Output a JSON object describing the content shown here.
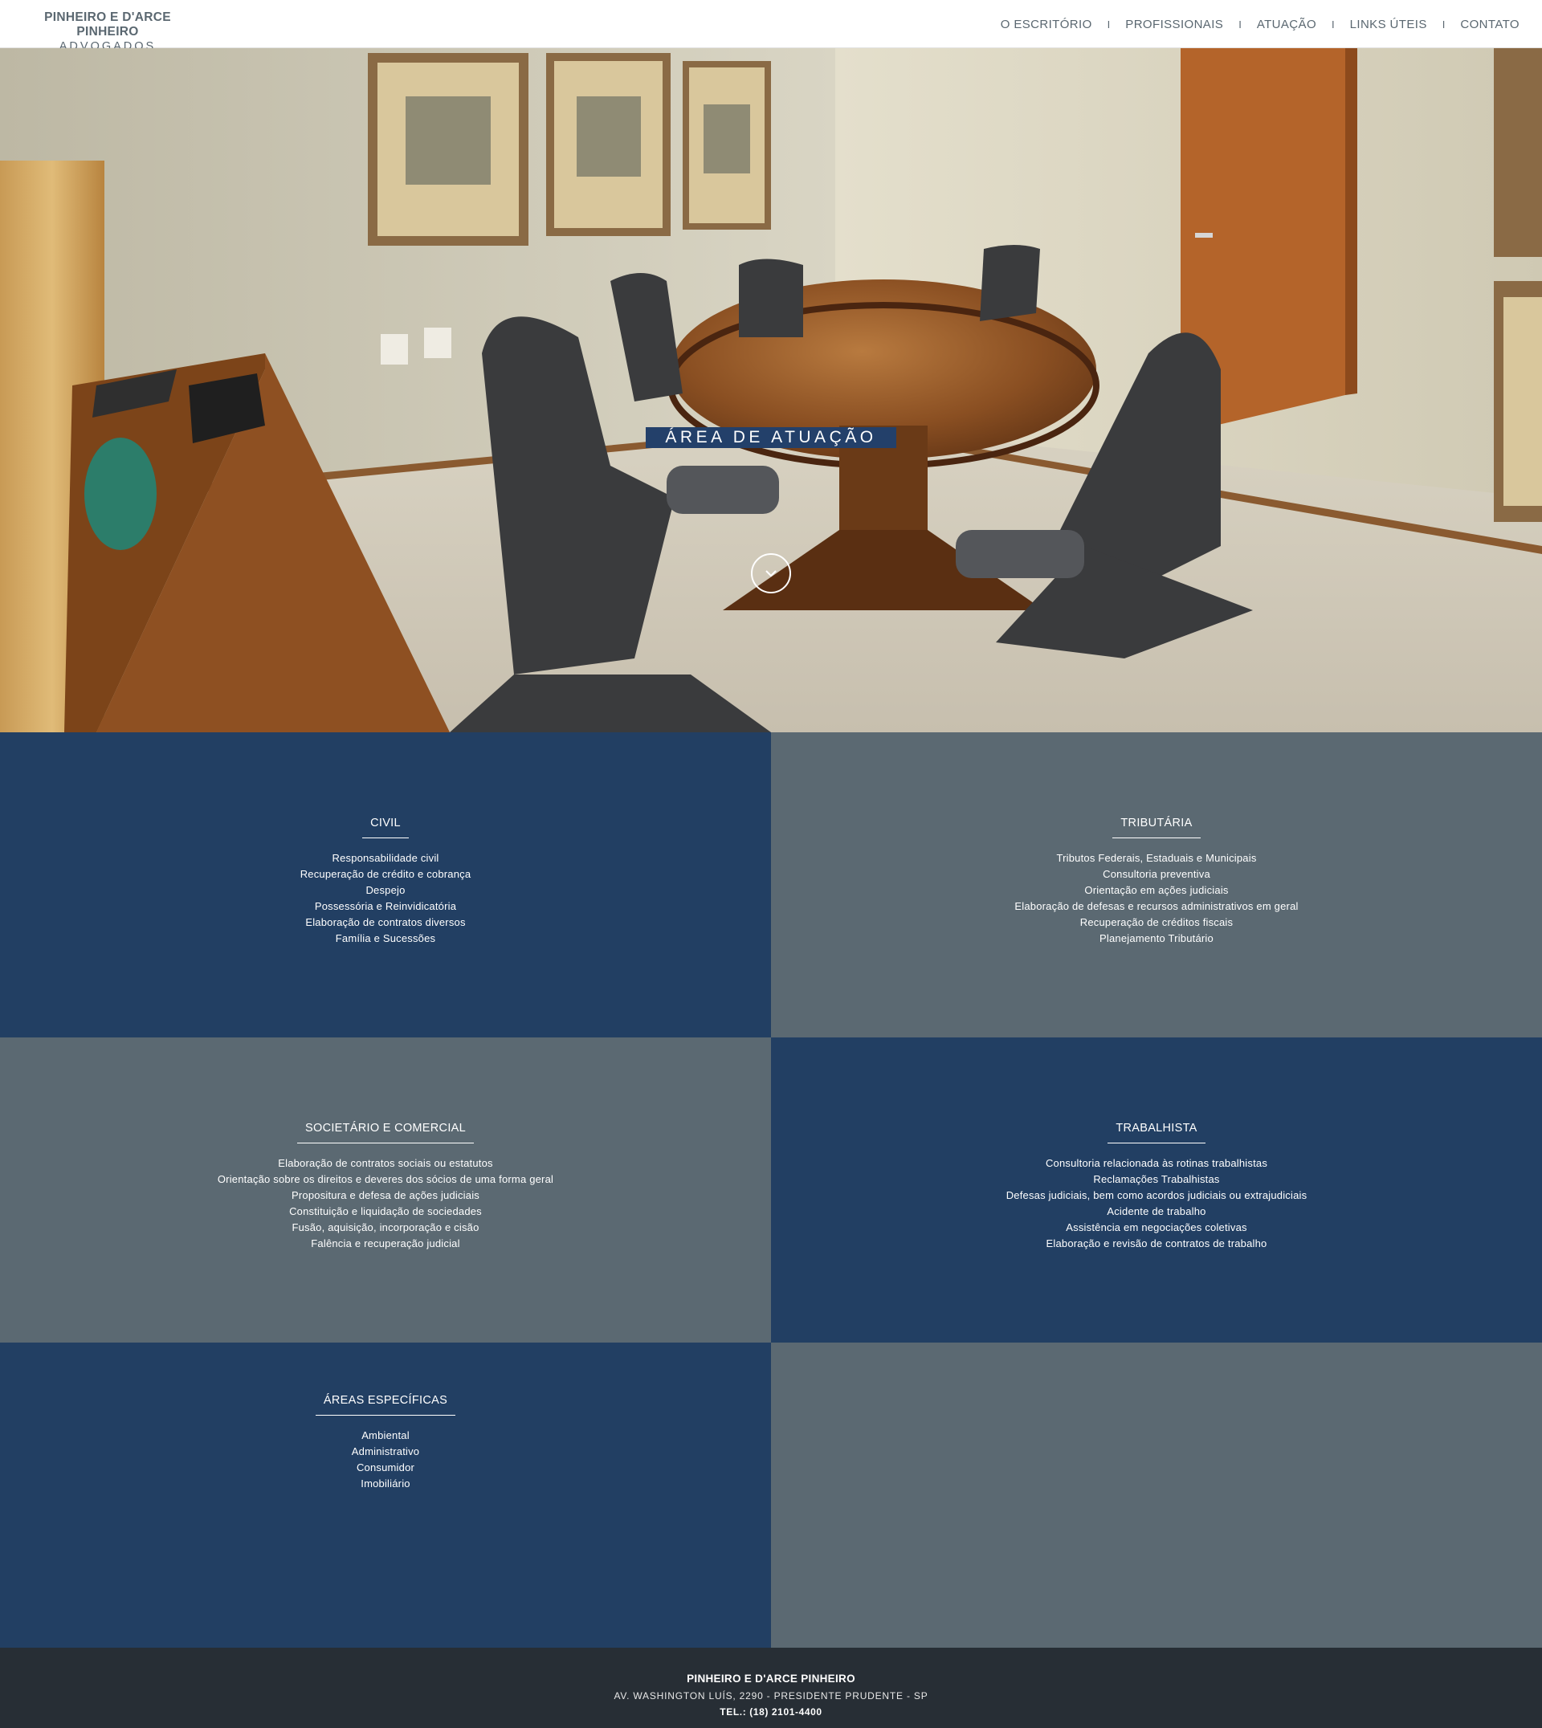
{
  "header": {
    "logo_line1": "PINHEIRO E D'ARCE PINHEIRO",
    "logo_line2": "ADVOGADOS",
    "nav": [
      {
        "label": "O ESCRITÓRIO"
      },
      {
        "label": "PROFISSIONAIS"
      },
      {
        "label": "ATUAÇÃO"
      },
      {
        "label": "LINKS ÚTEIS"
      },
      {
        "label": "CONTATO"
      }
    ],
    "nav_separator": "I"
  },
  "hero": {
    "title": "ÁREA DE ATUAÇÃO",
    "scroll_icon": "chevron-down-icon"
  },
  "areas": [
    {
      "title": "CIVIL",
      "items": [
        "Responsabilidade civil",
        "Recuperação de crédito e cobrança",
        "Despejo",
        "Possessória e Reinvidicatória",
        "Elaboração de contratos diversos",
        "Família e Sucessões"
      ]
    },
    {
      "title": "TRIBUTÁRIA",
      "items": [
        "Tributos Federais, Estaduais e Municipais",
        "Consultoria preventiva",
        "Orientação em ações judiciais",
        "Elaboração de defesas e recursos administrativos em geral",
        "Recuperação de créditos fiscais",
        "Planejamento Tributário"
      ]
    },
    {
      "title": "SOCIETÁRIO E COMERCIAL",
      "items": [
        "Elaboração de contratos sociais ou estatutos",
        "Orientação sobre os direitos e deveres dos sócios de uma forma geral",
        "Propositura e defesa de ações judiciais",
        "Constituição e liquidação de sociedades",
        "Fusão, aquisição, incorporação e cisão",
        "Falência e recuperação judicial"
      ]
    },
    {
      "title": "TRABALHISTA",
      "items": [
        "Consultoria relacionada às rotinas trabalhistas",
        "Reclamações Trabalhistas",
        "Defesas judiciais, bem como acordos judiciais ou extrajudiciais",
        "Acidente de trabalho",
        "Assistência em negociações coletivas",
        "Elaboração e revisão de contratos de trabalho"
      ]
    },
    {
      "title": "ÁREAS ESPECÍFICAS",
      "items": [
        "Ambiental",
        "Administrativo",
        "Consumidor",
        "Imobiliário"
      ]
    }
  ],
  "footer": {
    "name": "PINHEIRO E D'ARCE PINHEIRO",
    "address": "AV. WASHINGTON LUÍS, 2290 - PRESIDENTE PRUDENTE - SP",
    "phone": "TEL.: (18) 2101-4400"
  },
  "colors": {
    "panel_dark": "#223f63",
    "panel_grey": "#5b6972",
    "footer_bg": "#272e35",
    "hero_title_bg": "#23406a",
    "header_text": "#5a6770"
  }
}
